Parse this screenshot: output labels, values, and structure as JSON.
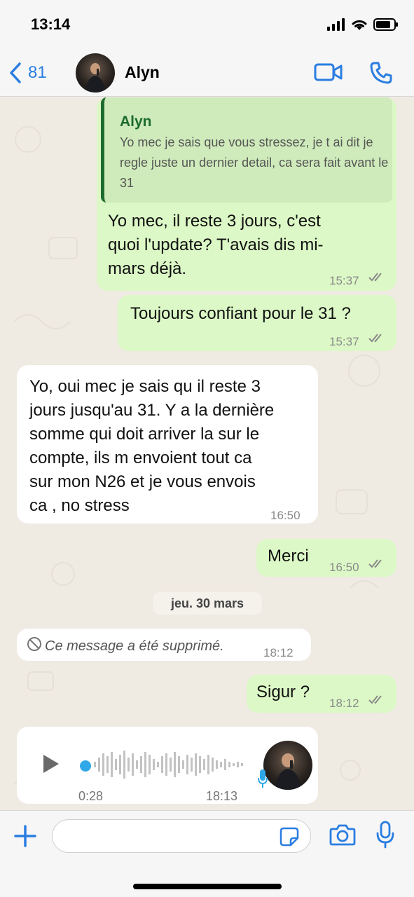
{
  "status_bar": {
    "time": "13:14"
  },
  "header": {
    "back_count": "81",
    "contact_name": "Alyn"
  },
  "messages": [
    {
      "direction": "outgoing",
      "quote": {
        "author": "Alyn",
        "text": "Yo mec je sais que vous stressez, je t ai dit je regle juste un dernier detail, ca sera fait avant le 31"
      },
      "lines": [
        "Yo mec, il reste 3 jours, c'est",
        "quoi l'update? T'avais dis mi-",
        "mars déjà."
      ],
      "time": "15:37",
      "ticks": "read"
    },
    {
      "direction": "outgoing",
      "lines": [
        "Toujours confiant pour le 31 ?"
      ],
      "time": "15:37",
      "ticks": "read"
    },
    {
      "direction": "incoming",
      "lines": [
        "Yo, oui mec je sais qu il reste 3",
        "jours jusqu'au 31. Y a la dernière",
        "somme qui doit arriver la sur le",
        "compte, ils m envoient tout ca",
        "sur mon N26 et je vous envois",
        "ca , no stress"
      ],
      "time": "16:50"
    },
    {
      "direction": "outgoing",
      "lines": [
        "Merci"
      ],
      "time": "16:50",
      "ticks": "read"
    },
    {
      "direction": "incoming",
      "deleted": true,
      "lines": [
        "Ce message a été supprimé."
      ],
      "time": "18:12"
    },
    {
      "direction": "outgoing",
      "lines": [
        "Sigur ?"
      ],
      "time": "18:12",
      "ticks": "read"
    },
    {
      "direction": "incoming",
      "voice": true,
      "duration": "0:28",
      "time": "18:13"
    }
  ],
  "date_separator": "jeu. 30 mars",
  "colors": {
    "accent": "#2a7de1",
    "outgoing_bubble": "#dcf8c6",
    "incoming_bubble": "#ffffff",
    "chat_background": "#efeae2",
    "voice_accent": "#30a8e8"
  },
  "icons": {
    "back": "chevron-left-icon",
    "video": "video-camera-icon",
    "phone": "phone-icon",
    "plus": "plus-icon",
    "sticker": "sticker-icon",
    "camera": "camera-icon",
    "mic": "microphone-icon",
    "play": "play-icon",
    "deleted": "blocked-icon"
  }
}
